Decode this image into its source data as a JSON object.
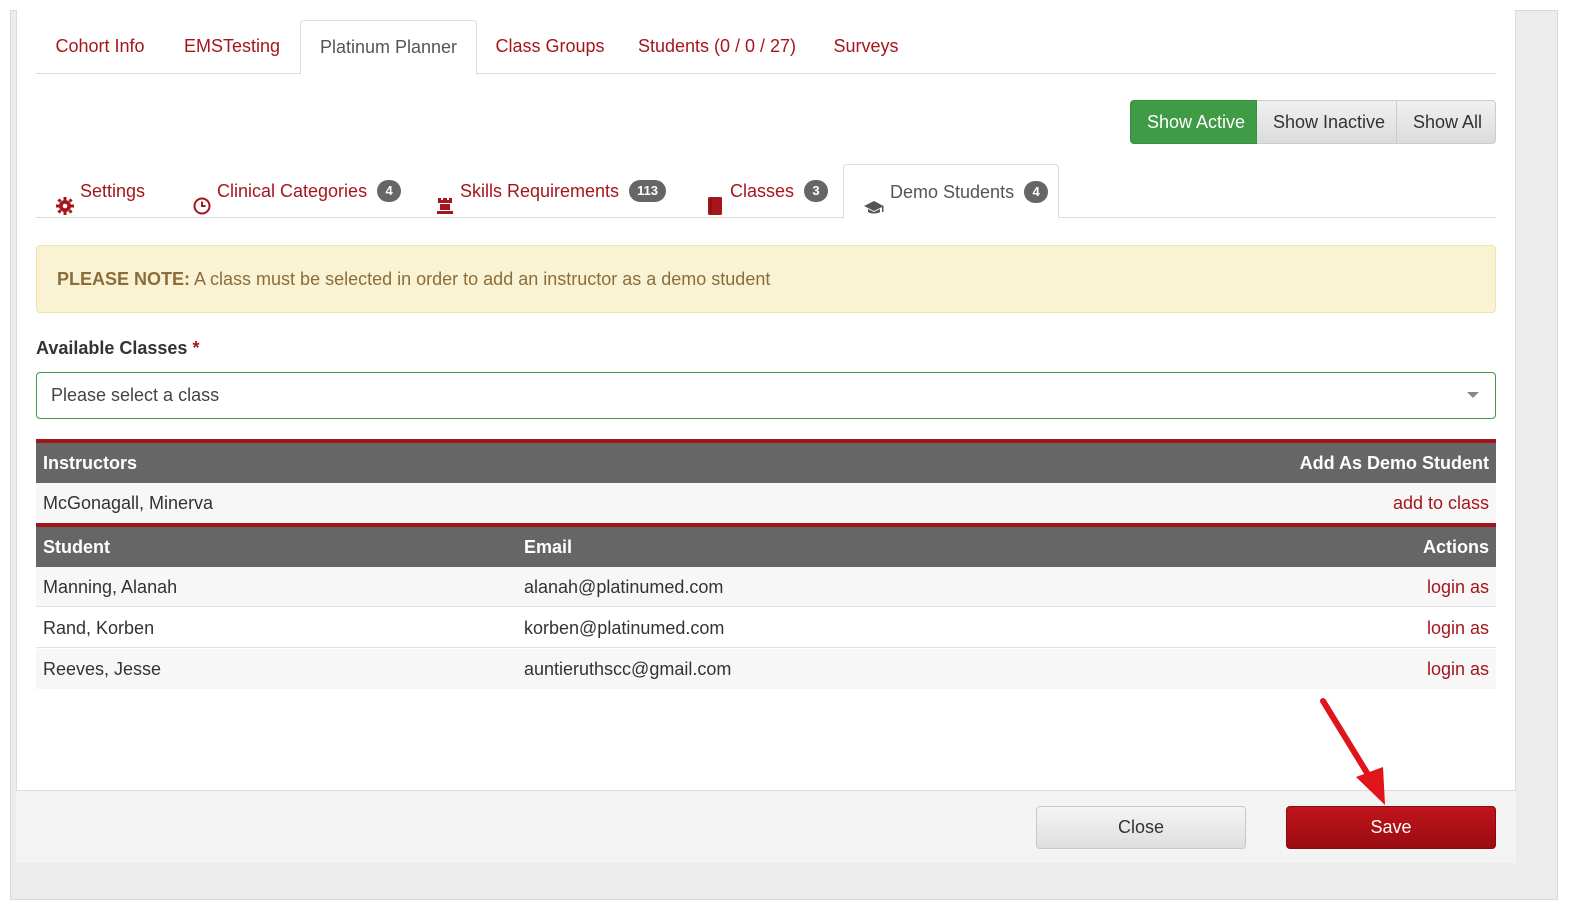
{
  "top_tabs": [
    {
      "label": "Cohort Info"
    },
    {
      "label": "EMSTesting"
    },
    {
      "label": "Platinum Planner"
    },
    {
      "label": "Class Groups"
    },
    {
      "label": "Students (0 / 0 / 27)"
    },
    {
      "label": "Surveys"
    }
  ],
  "filters": {
    "active": "Show Active",
    "inactive": "Show Inactive",
    "all": "Show All"
  },
  "sub_tabs": [
    {
      "label": "Settings",
      "icon": "gear-icon"
    },
    {
      "label": "Clinical Categories",
      "icon": "clock-icon",
      "badge": "4"
    },
    {
      "label": "Skills Requirements",
      "icon": "rook-icon",
      "badge": "113"
    },
    {
      "label": "Classes",
      "icon": "book-icon",
      "badge": "3"
    },
    {
      "label": "Demo Students",
      "icon": "graduation-cap-icon",
      "badge": "4"
    }
  ],
  "alert": {
    "strong": "PLEASE NOTE:",
    "text": " A class must be selected in order to add an instructor as a demo student"
  },
  "available_classes": {
    "label": "Available Classes",
    "required": "*",
    "placeholder": "Please select a class"
  },
  "instructors_table": {
    "headers": {
      "name": "Instructors",
      "action": "Add As Demo Student"
    },
    "rows": [
      {
        "name": "McGonagall, Minerva",
        "action": "add to class"
      }
    ]
  },
  "students_table": {
    "headers": {
      "student": "Student",
      "email": "Email",
      "actions": "Actions"
    },
    "rows": [
      {
        "student": "Manning, Alanah",
        "email": "alanah@platinumed.com",
        "action": "login as"
      },
      {
        "student": "Rand, Korben",
        "email": "korben@platinumed.com",
        "action": "login as"
      },
      {
        "student": "Reeves, Jesse",
        "email": "auntieruthscc@gmail.com",
        "action": "login as"
      }
    ]
  },
  "footer": {
    "close": "Close",
    "save": "Save"
  },
  "colors": {
    "brand": "#a5161c",
    "active_green": "#3f9b46",
    "arrow": "#e0141b"
  }
}
